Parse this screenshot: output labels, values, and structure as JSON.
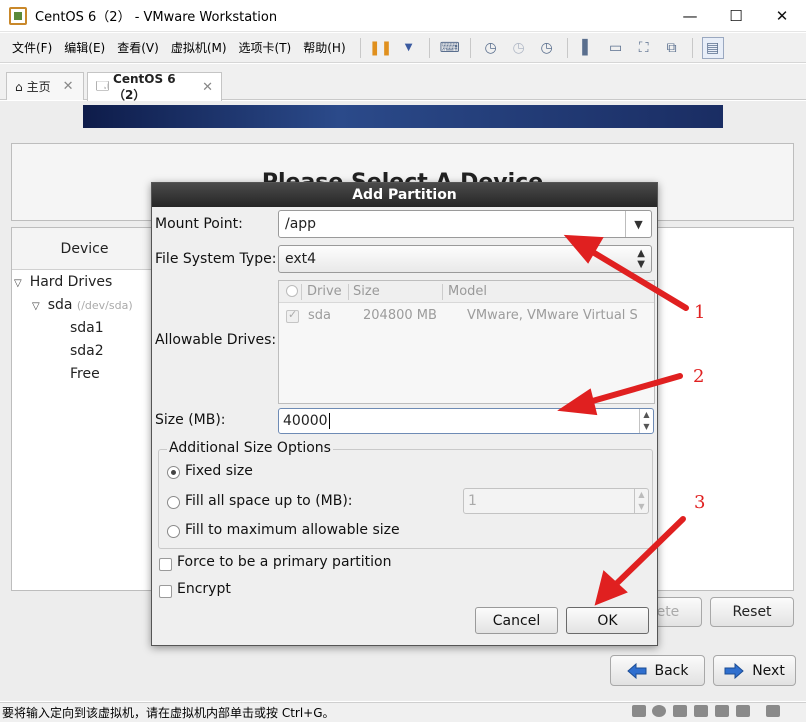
{
  "window": {
    "title": "CentOS 6（2） - VMware Workstation",
    "controls": {
      "minimize": "—",
      "maximize": "☐",
      "close": "✕"
    }
  },
  "menu": {
    "items": [
      "文件(F)",
      "编辑(E)",
      "查看(V)",
      "虚拟机(M)",
      "选项卡(T)",
      "帮助(H)"
    ]
  },
  "tabs": [
    {
      "label": "主页",
      "icon": "home-icon"
    },
    {
      "label": "CentOS 6（2）",
      "icon": "vm-icon"
    }
  ],
  "installer": {
    "heading": "Please Select A Device",
    "device_column": "Device",
    "tree": {
      "hard_drives": "Hard Drives",
      "disk": "sda",
      "disk_path": "(/dev/sda)",
      "partitions": [
        "sda1",
        "sda2",
        "Free"
      ]
    },
    "buttons": {
      "delete": "lete",
      "reset": "Reset"
    },
    "nav": {
      "back": "Back",
      "next": "Next"
    }
  },
  "dialog": {
    "title": "Add Partition",
    "mount_point_label": "Mount Point:",
    "mount_point_value": "/app",
    "fs_type_label": "File System Type:",
    "fs_type_value": "ext4",
    "allowable_drives_label": "Allowable Drives:",
    "drives_columns": [
      "Drive",
      "Size",
      "Model"
    ],
    "drives_rows": [
      {
        "drive": "sda",
        "size": "204800 MB",
        "model": "VMware, VMware Virtual S",
        "checked": true
      }
    ],
    "size_label": "Size (MB):",
    "size_value": "40000",
    "additional_legend": "Additional Size Options",
    "options": {
      "fixed": "Fixed size",
      "fill_up_to": "Fill all space up to (MB):",
      "fill_up_to_value": "1",
      "fill_max": "Fill to maximum allowable size"
    },
    "selected_option": "fixed",
    "force_primary": "Force to be a primary partition",
    "encrypt": "Encrypt",
    "cancel": "Cancel",
    "ok": "OK"
  },
  "annotations": {
    "n1": "1",
    "n2": "2",
    "n3": "3",
    "color": "#e02020"
  },
  "statusbar": {
    "text": "要将输入定向到该虚拟机，请在虚拟机内部单击或按 Ctrl+G。"
  }
}
